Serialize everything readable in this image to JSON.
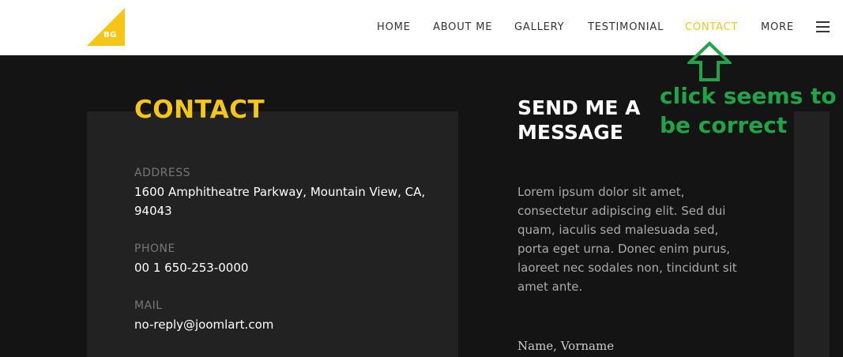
{
  "header": {
    "logo_text": "BG",
    "brand_color": "#f5c518",
    "nav": [
      {
        "label": "HOME"
      },
      {
        "label": "ABOUT ME"
      },
      {
        "label": "GALLERY"
      },
      {
        "label": "TESTIMONIAL"
      },
      {
        "label": "CONTACT",
        "active": true
      },
      {
        "label": "MORE"
      }
    ],
    "menu_icon": "hamburger-icon"
  },
  "contact": {
    "title": "CONTACT",
    "address_label": "ADDRESS",
    "address_value": "1600 Amphitheatre Parkway, Mountain View, CA, 94043",
    "phone_label": "PHONE",
    "phone_value": "00 1 650-253-0000",
    "mail_label": "MAIL",
    "mail_value": "no-reply@joomlart.com"
  },
  "message": {
    "title": "SEND ME A MESSAGE",
    "text": "Lorem ipsum dolor sit amet, consectetur adipiscing elit. Sed dui quam, iaculis sed malesuada sed, porta eget urna. Donec enim purus, laoreet nec sodales non, tincidunt sit amet ante.",
    "field_label": "Name, Vorname"
  },
  "annotation": {
    "text_line1": "click seems to",
    "text_line2": "be correct",
    "color": "#21a347",
    "icon": "up-arrow-icon"
  }
}
